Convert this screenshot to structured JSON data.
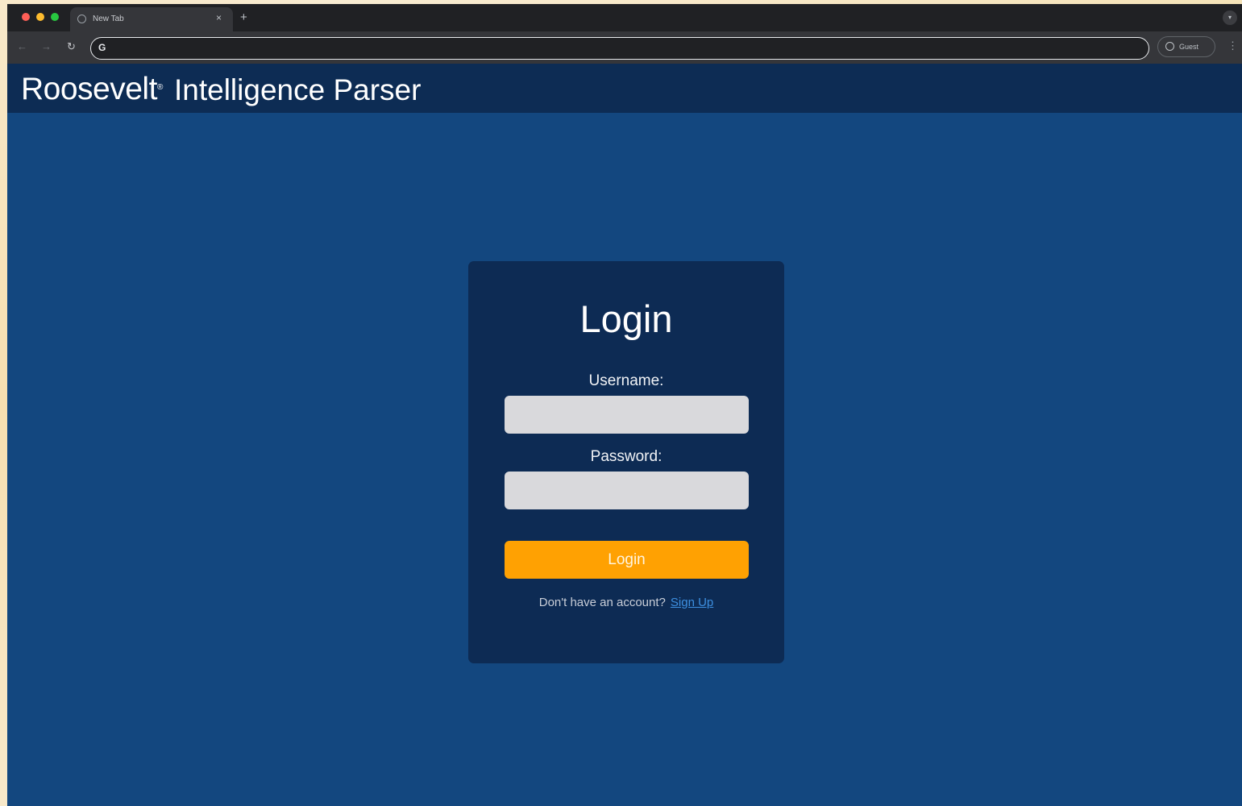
{
  "browser": {
    "tab_title": "New Tab",
    "tab_close": "×",
    "new_tab": "+",
    "omnibox_value": "",
    "profile_label": "Guest",
    "traffic_colors": {
      "close": "#ff5f57",
      "minimize": "#febc2e",
      "zoom": "#28c840"
    }
  },
  "header": {
    "brand": "Roosevelt",
    "brand_mark": "®",
    "title": "Intelligence Parser",
    "background": "#0d2c54"
  },
  "login": {
    "title": "Login",
    "username_label": "Username:",
    "username_value": "",
    "password_label": "Password:",
    "password_value": "",
    "button_label": "Login",
    "signup_prompt": "Don't have an account?",
    "signup_link": "Sign Up"
  },
  "colors": {
    "page_background": "#13477f",
    "card_background": "#0d2b54",
    "accent": "#ffa102",
    "link": "#3d8fe0",
    "input_background": "#d9d9dc"
  }
}
